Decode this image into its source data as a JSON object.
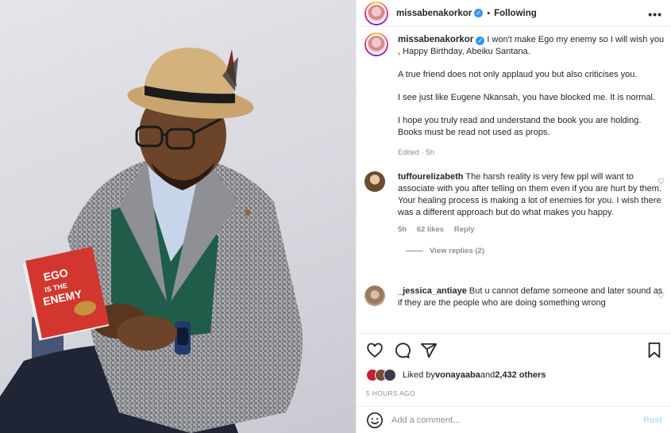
{
  "post": {
    "username": "missabenakorkor",
    "verified_mark": "✓",
    "separator": "•",
    "follow_status": "Following",
    "more_label": "•••"
  },
  "caption": {
    "username": "missabenakorkor",
    "paragraphs": [
      "I won't make Ego my enemy so I will wish you , Happy Birthday, Abeiku Santana.",
      "A true friend does not only applaud you but also criticises you.",
      "I see just like Eugene Nkansah, you have blocked me. It is normal.",
      "I hope you truly read and understand the book you are holding. Books must be read not used as props."
    ],
    "meta": "Edited · 5h"
  },
  "comments": [
    {
      "username": "tuffourelizabeth",
      "text": "The harsh reality is very few ppl will want to associate with you after telling on them even if you are hurt by them. Your healing process is making a lot of enemies for you. I wish there was a different approach but do what makes you happy.",
      "time": "5h",
      "likes": "62 likes",
      "reply": "Reply",
      "view_replies": "View replies (2)",
      "heart": "♡"
    },
    {
      "username": "_jessica_antiaye",
      "text": "But u cannot defame someone and later sound as if they are the people who are doing something wrong",
      "heart": "♡"
    }
  ],
  "likes": {
    "prefix": "Liked by ",
    "user": "vonayaaba",
    "connector": " and ",
    "others": "2,432 others"
  },
  "timestamp": "5 HOURS AGO",
  "add_comment": {
    "placeholder": "Add a comment...",
    "post_label": "Post"
  },
  "book": {
    "line1": "EGO",
    "line2": "IS THE",
    "line3": "ENEMY"
  },
  "colors": {
    "text": "#262626",
    "muted": "#8e8e8e",
    "verified": "#3897f0",
    "post_disabled": "#b2dffc",
    "book_red": "#d2362f"
  }
}
